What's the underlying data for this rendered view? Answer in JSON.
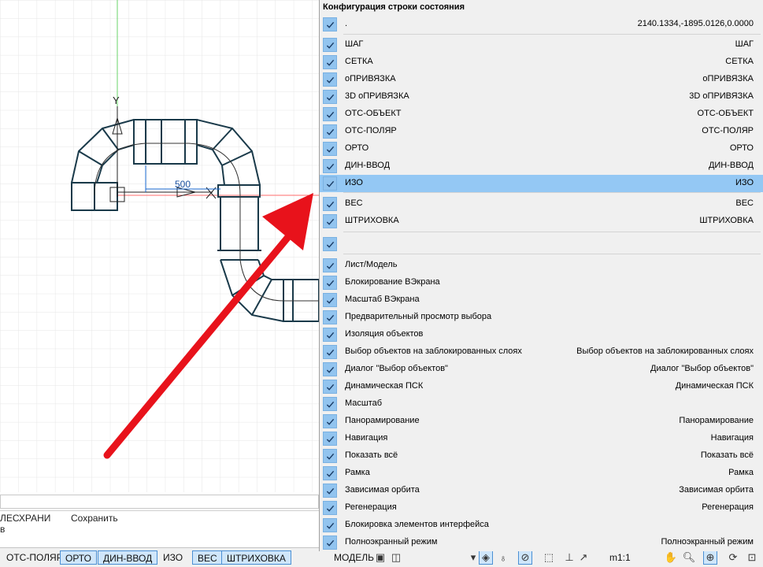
{
  "menu": {
    "title": "Конфигурация строки состояния",
    "rows": [
      {
        "label": ".",
        "value": "2140.1334,-1895.0126,0.0000",
        "checked": true
      },
      {
        "label": "ШАГ",
        "value": "ШАГ",
        "checked": true
      },
      {
        "label": "СЕТКА",
        "value": "СЕТКА",
        "checked": true
      },
      {
        "label": "оПРИВЯЗКА",
        "value": "оПРИВЯЗКА",
        "checked": true
      },
      {
        "label": "3D оПРИВЯЗКА",
        "value": "3D оПРИВЯЗКА",
        "checked": true
      },
      {
        "label": "ОТС-ОБЪЕКТ",
        "value": "ОТС-ОБЪЕКТ",
        "checked": true
      },
      {
        "label": "ОТС-ПОЛЯР",
        "value": "ОТС-ПОЛЯР",
        "checked": true
      },
      {
        "label": "ОРТО",
        "value": "ОРТО",
        "checked": true
      },
      {
        "label": "ДИН-ВВОД",
        "value": "ДИН-ВВОД",
        "checked": true
      },
      {
        "label": "ИЗО",
        "value": "ИЗО",
        "checked": true,
        "highlighted": true
      },
      {
        "label": "ВЕС",
        "value": "ВЕС",
        "checked": true
      },
      {
        "label": "ШТРИХОВКА",
        "value": "ШТРИХОВКА",
        "checked": true
      },
      {
        "label": "",
        "value": "",
        "checked": true
      },
      {
        "label": "Лист/Модель",
        "value": "",
        "checked": true
      },
      {
        "label": "Блокирование ВЭкрана",
        "value": "",
        "checked": true
      },
      {
        "label": "Масштаб ВЭкрана",
        "value": "",
        "checked": true
      },
      {
        "label": "Предварительный просмотр выбора",
        "value": "",
        "checked": true
      },
      {
        "label": "Изоляция объектов",
        "value": "",
        "checked": true
      },
      {
        "label": "Выбор объектов на заблокированных слоях",
        "value": "Выбор объектов на заблокированных слоях",
        "checked": true
      },
      {
        "label": "Диалог \"Выбор объектов\"",
        "value": "Диалог \"Выбор объектов\"",
        "checked": true
      },
      {
        "label": "Динамическая ПСК",
        "value": "Динамическая ПСК",
        "checked": true
      },
      {
        "label": "Масштаб",
        "value": "",
        "checked": true
      },
      {
        "label": "Панорамирование",
        "value": "Панорамирование",
        "checked": true
      },
      {
        "label": "Навигация",
        "value": "Навигация",
        "checked": true
      },
      {
        "label": "Показать всё",
        "value": "Показать всё",
        "checked": true
      },
      {
        "label": "Рамка",
        "value": "Рамка",
        "checked": true
      },
      {
        "label": "Зависимая орбита",
        "value": "Зависимая орбита",
        "checked": true
      },
      {
        "label": "Регенерация",
        "value": "Регенерация",
        "checked": true
      },
      {
        "label": "Блокировка элементов интерфейса",
        "value": "",
        "checked": true
      },
      {
        "label": "Полноэкранный режим",
        "value": "Полноэкранный режим",
        "checked": true
      }
    ]
  },
  "drawing": {
    "axis_label_y": "Y",
    "dimension_text": "500"
  },
  "palette": {
    "line1_left": "ЛЕСХРАНИ",
    "line1_right": "Сохранить",
    "line2": "в"
  },
  "statusbar": {
    "otc_polar": "ОТС-ПОЛЯР",
    "orto": "ОРТО",
    "din_vvod": "ДИН-ВВОД",
    "izo": "ИЗО",
    "ves": "ВЕС",
    "shtrihovka": "ШТРИХОВКА",
    "model": "МОДЕЛЬ",
    "scale": "m1:1"
  },
  "colors": {
    "duct_stroke": "#1a3a4a",
    "arrow": "#e8121b",
    "highlight": "#94c8f4",
    "checkbox": "#92c4ef",
    "y_axis": "#6ad46a",
    "x_axis": "#ff6b6b"
  },
  "icons": [
    "check-icon",
    "hand-icon",
    "lightbulb-icon",
    "zoom-icon",
    "fullscreen-icon",
    "customize-icon",
    "grid-icon"
  ]
}
